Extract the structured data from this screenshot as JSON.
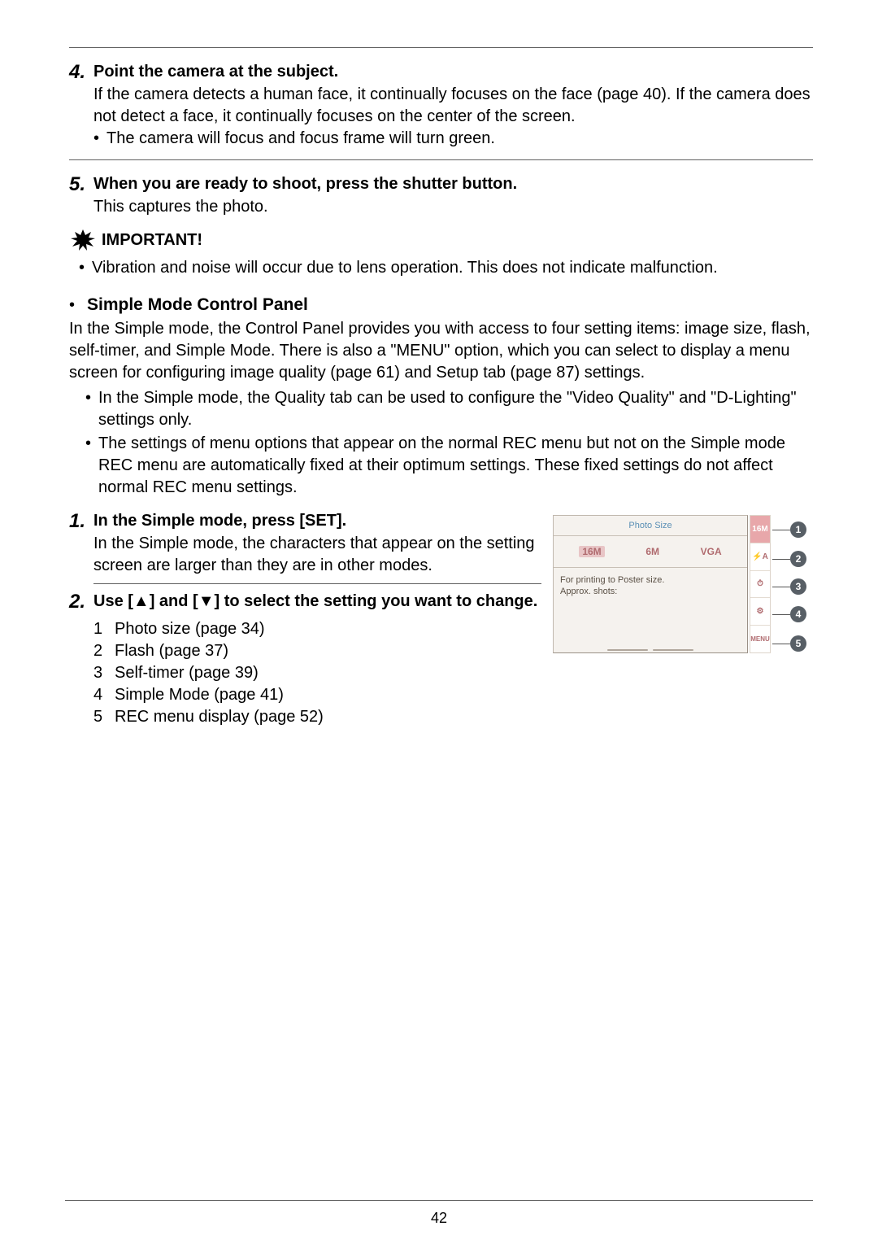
{
  "step4": {
    "num": "4.",
    "title": "Point the camera at the subject.",
    "body": "If the camera detects a human face, it continually focuses on the face (page 40). If the camera does not detect a face, it continually focuses on the center of the screen.",
    "bullet": "The camera will focus and focus frame will turn green."
  },
  "step5": {
    "num": "5.",
    "title": "When you are ready to shoot, press the shutter button.",
    "body": "This captures the photo."
  },
  "important": {
    "label": "IMPORTANT!",
    "bullet": "Vibration and noise will occur due to lens operation. This does not indicate malfunction."
  },
  "section": {
    "dot": "•",
    "title": "Simple Mode Control Panel",
    "intro": "In the Simple mode, the Control Panel provides you with access to four setting items: image size, flash, self-timer, and Simple Mode. There is also a \"MENU\" option, which you can select to display a menu screen for configuring image quality (page 61) and Setup tab (page 87) settings.",
    "bullets": [
      "In the Simple mode, the Quality tab can be used to configure the \"Video Quality\" and \"D-Lighting\" settings only.",
      "The settings of menu options that appear on the normal REC menu but not on the Simple mode REC menu are automatically fixed at their optimum settings. These fixed settings do not affect normal REC menu settings."
    ]
  },
  "cp_step1": {
    "num": "1.",
    "title": "In the Simple mode, press [SET].",
    "body": "In the Simple mode, the characters that appear on the setting screen are larger than they are in other modes."
  },
  "cp_step2": {
    "num": "2.",
    "title": "Use [▲] and [▼] to select the setting you want to change."
  },
  "legend": [
    "Photo size (page 34)",
    "Flash (page 37)",
    "Self-timer (page 39)",
    "Simple Mode (page 41)",
    "REC menu display (page 52)"
  ],
  "diagram": {
    "title": "Photo Size",
    "opts": [
      "16M",
      "6M",
      "VGA"
    ],
    "desc1": "For printing to Poster size.",
    "desc2": "Approx. shots:",
    "side": [
      "16M",
      "⚡A",
      "⏱",
      "⚙",
      "MENU"
    ]
  },
  "page_number": "42"
}
